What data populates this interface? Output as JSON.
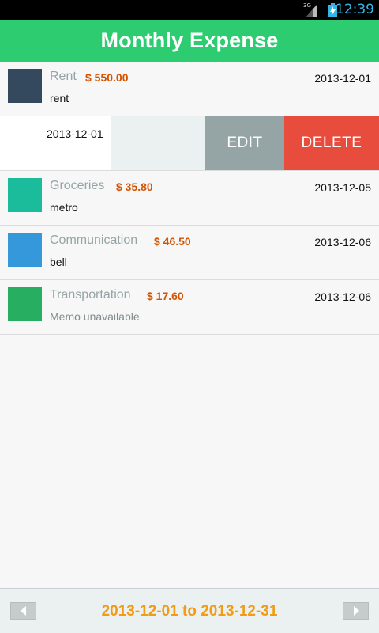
{
  "status_bar": {
    "network": "3G",
    "time": "12:39"
  },
  "app": {
    "title": "Monthly Expense"
  },
  "expenses": [
    {
      "category": "Rent",
      "amount": "$ 550.00",
      "date": "2013-12-01",
      "memo": "rent",
      "color": "#34495e"
    },
    {
      "category": "",
      "amount": "",
      "date": "2013-12-01",
      "memo": "",
      "color": ""
    },
    {
      "category": "Groceries",
      "amount": "$ 35.80",
      "date": "2013-12-05",
      "memo": "metro",
      "color": "#1abc9c"
    },
    {
      "category": "Communication",
      "amount": "$ 46.50",
      "date": "2013-12-06",
      "memo": "bell",
      "color": "#3498db"
    },
    {
      "category": "Transportation",
      "amount": "$ 17.60",
      "date": "2013-12-06",
      "memo": "Memo unavailable",
      "color": "#27ae60"
    }
  ],
  "row_actions": {
    "edit_label": "EDIT",
    "delete_label": "DELETE"
  },
  "footer": {
    "range_text": "2013-12-01 to 2013-12-31"
  },
  "colors": {
    "title_bar": "#2ecc71",
    "amount": "#d35400",
    "delete": "#e74c3c",
    "edit": "#95a5a6",
    "range": "#f39c12"
  }
}
